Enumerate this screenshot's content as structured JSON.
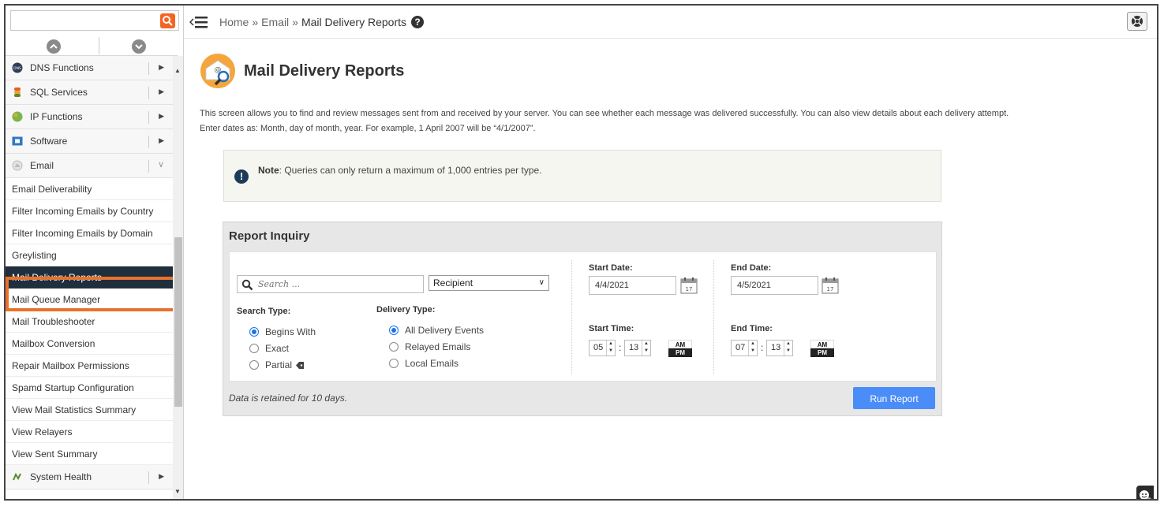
{
  "sidebar": {
    "search": {
      "placeholder": "",
      "value": ""
    },
    "categories_top": [
      {
        "label": "DNS Functions",
        "icon": "dns-icon"
      },
      {
        "label": "SQL Services",
        "icon": "database-icon"
      },
      {
        "label": "IP Functions",
        "icon": "globe-icon"
      },
      {
        "label": "Software",
        "icon": "software-icon"
      },
      {
        "label": "Email",
        "icon": "email-icon"
      }
    ],
    "email_items": [
      {
        "label": "Email Deliverability"
      },
      {
        "label": "Filter Incoming Emails by Country"
      },
      {
        "label": "Filter Incoming Emails by Domain"
      },
      {
        "label": "Greylisting"
      },
      {
        "label": "Mail Delivery Reports",
        "active": true
      },
      {
        "label": "Mail Queue Manager"
      },
      {
        "label": "Mail Troubleshooter"
      },
      {
        "label": "Mailbox Conversion"
      },
      {
        "label": "Repair Mailbox Permissions"
      },
      {
        "label": "Spamd Startup Configuration"
      },
      {
        "label": "View Mail Statistics Summary"
      },
      {
        "label": "View Relayers"
      },
      {
        "label": "View Sent Summary"
      }
    ],
    "categories_bottom": [
      {
        "label": "System Health",
        "icon": "health-icon"
      }
    ]
  },
  "breadcrumb": {
    "home": "Home",
    "sep1": "»",
    "email": "Email",
    "sep2": "»",
    "current": "Mail Delivery Reports",
    "help": "?"
  },
  "page": {
    "title": "Mail Delivery Reports",
    "description_1": "This screen allows you to find and review messages sent from and received by your server. You can see whether each message was delivered successfully. You can also view details about each delivery attempt.",
    "description_2": "Enter dates as: Month, day of month, year. For example, 1 April 2007 will be “4/1/2007”."
  },
  "note": {
    "icon": "!",
    "label": "Note",
    "text": ": Queries can only return a maximum of 1,000 entries per type."
  },
  "report": {
    "title": "Report Inquiry",
    "search_placeholder": "Search ...",
    "field_select": "Recipient",
    "search_type_label": "Search Type:",
    "search_types": [
      {
        "label": "Begins With",
        "checked": true
      },
      {
        "label": "Exact",
        "checked": false
      },
      {
        "label": "Partial",
        "checked": false
      }
    ],
    "delivery_type_label": "Delivery Type:",
    "delivery_types": [
      {
        "label": "All Delivery Events",
        "checked": true
      },
      {
        "label": "Relayed Emails",
        "checked": false
      },
      {
        "label": "Local Emails",
        "checked": false
      }
    ],
    "start_date_label": "Start Date:",
    "start_date": "4/4/2021",
    "end_date_label": "End Date:",
    "end_date": "4/5/2021",
    "calendar_day": "17",
    "start_time_label": "Start Time:",
    "start_hour": "05",
    "start_minute": "13",
    "end_time_label": "End Time:",
    "end_hour": "07",
    "end_minute": "13",
    "am": "AM",
    "pm": "PM",
    "colon": ":",
    "retain_text": "Data is retained for 10 days.",
    "run_button": "Run Report"
  },
  "colors": {
    "accent_orange": "#e8722c",
    "active_bg": "#1f2f3d",
    "button_blue": "#4b8df8"
  }
}
